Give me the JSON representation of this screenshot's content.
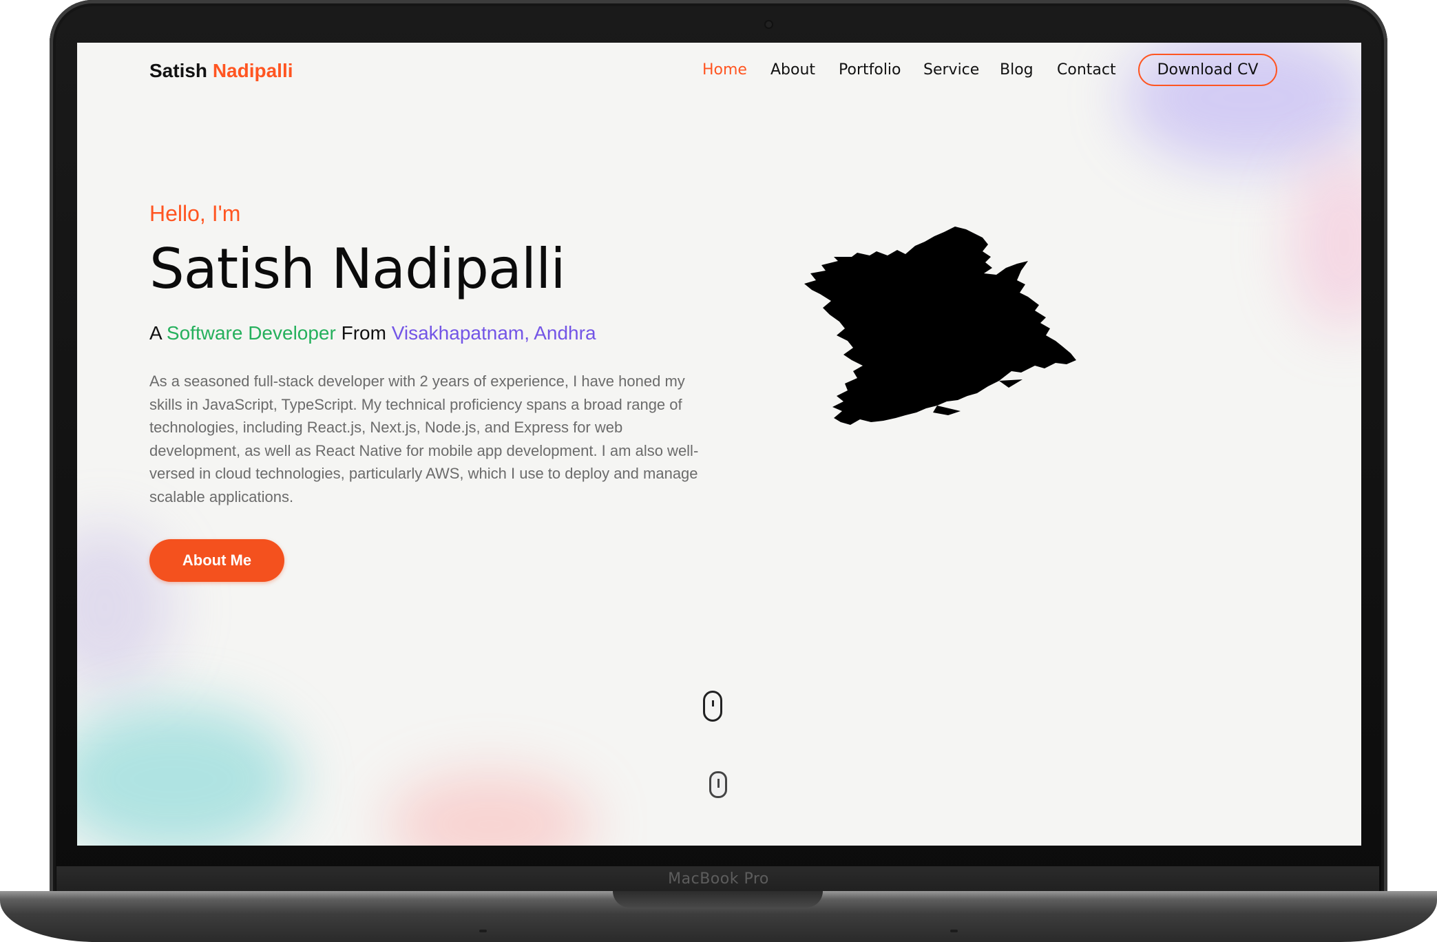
{
  "device": {
    "label": "MacBook Pro"
  },
  "site": {
    "logo": {
      "first": "Satish",
      "last": "Nadipalli"
    },
    "nav": [
      {
        "label": "Home",
        "active": true
      },
      {
        "label": "About",
        "active": false
      },
      {
        "label": "Portfolio",
        "active": false
      },
      {
        "label": "Service",
        "active": false
      },
      {
        "label": "Blog",
        "active": false
      },
      {
        "label": "Contact",
        "active": false
      }
    ],
    "cv_button": "Download CV"
  },
  "hero": {
    "greeting": "Hello, I'm",
    "name": "Satish Nadipalli",
    "tagline": {
      "prefix": "A",
      "role": "Software Developer",
      "middle": "From",
      "place": "Visakhapatnam, Andhra"
    },
    "bio": "As a seasoned full-stack developer with 2 years of experience, I have honed my skills in JavaScript, TypeScript. My technical proficiency spans a broad range of technologies, including React.js, Next.js, Node.js, and Express for web development, as well as React Native for mobile app development. I am also well-versed in cloud technologies, particularly AWS, which I use to deploy and manage scalable applications.",
    "cta": "About Me"
  },
  "colors": {
    "accent": "#ff5521",
    "role": "#25b05c",
    "place": "#7355e6",
    "background": "#f5f5f3",
    "text": "#111111",
    "muted": "#6b6b6b"
  },
  "icons": [
    "scroll-mouse-icon",
    "scroll-mouse-icon-secondary"
  ]
}
